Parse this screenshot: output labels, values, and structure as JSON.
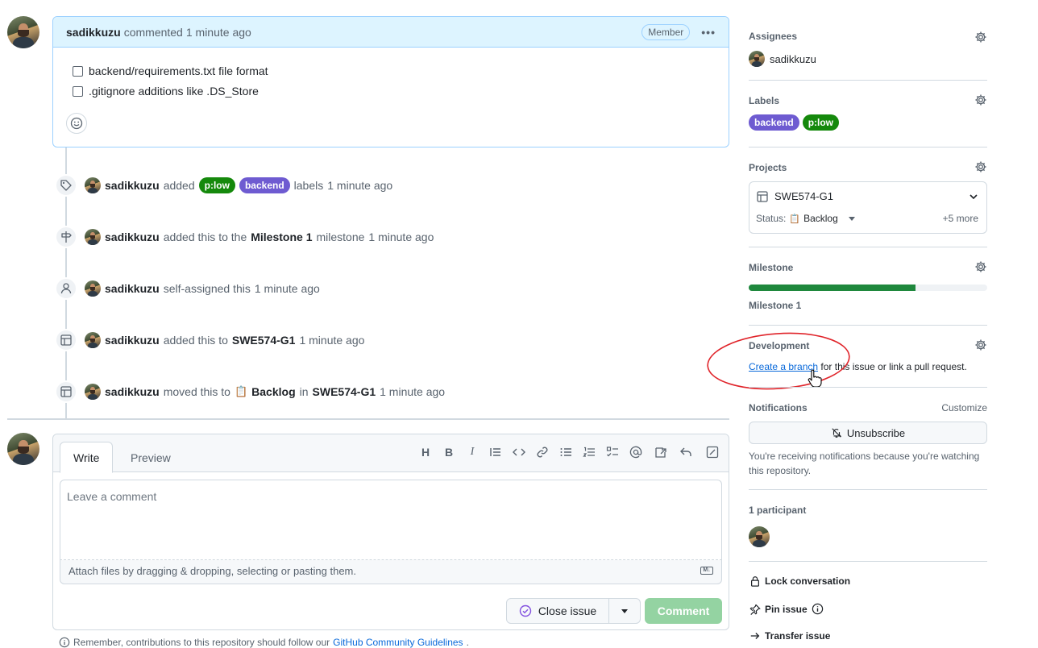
{
  "comment": {
    "author": "sadikkuzu",
    "action": "commented",
    "time": "1 minute ago",
    "role_badge": "Member",
    "tasks": [
      {
        "label": "backend/requirements.txt file format",
        "checked": false
      },
      {
        "label": ".gitignore additions like .DS_Store",
        "checked": false
      }
    ]
  },
  "timeline": {
    "labels_event": {
      "user": "sadikkuzu",
      "verb": "added",
      "label1": "p:low",
      "label2": "backend",
      "suffix": "labels",
      "time": "1 minute ago"
    },
    "milestone_event": {
      "user": "sadikkuzu",
      "verb": "added this to the",
      "target": "Milestone 1",
      "suffix": "milestone",
      "time": "1 minute ago"
    },
    "assign_event": {
      "user": "sadikkuzu",
      "verb": "self-assigned this",
      "time": "1 minute ago"
    },
    "project_event": {
      "user": "sadikkuzu",
      "verb": "added this to",
      "target": "SWE574-G1",
      "time": "1 minute ago"
    },
    "move_event": {
      "user": "sadikkuzu",
      "verb": "moved this to",
      "status": "Backlog",
      "in": "in",
      "target": "SWE574-G1",
      "time": "1 minute ago"
    }
  },
  "composer": {
    "tab_write": "Write",
    "tab_preview": "Preview",
    "placeholder": "Leave a comment",
    "attach_hint": "Attach files by dragging & dropping, selecting or pasting them.",
    "close_issue": "Close issue",
    "comment_button": "Comment",
    "guidelines_prefix": "Remember, contributions to this repository should follow our",
    "guidelines_link": "GitHub Community Guidelines",
    "guidelines_suffix": "."
  },
  "sidebar": {
    "assignees_title": "Assignees",
    "assignee": "sadikkuzu",
    "labels_title": "Labels",
    "labels": [
      {
        "name": "backend",
        "color": "#6e5bd1"
      },
      {
        "name": "p:low",
        "color": "#15890c"
      }
    ],
    "projects_title": "Projects",
    "project_name": "SWE574-G1",
    "status_label": "Status:",
    "status_value": "Backlog",
    "more": "+5 more",
    "milestone_title": "Milestone",
    "milestone_progress": 0.7,
    "milestone_name": "Milestone 1",
    "development_title": "Development",
    "dev_link": "Create a branch",
    "dev_text": "for this issue or link a pull request.",
    "notifications_title": "Notifications",
    "customize": "Customize",
    "unsubscribe": "Unsubscribe",
    "notif_reason": "You're receiving notifications because you're watching this repository.",
    "participants": "1 participant",
    "lock": "Lock conversation",
    "pin": "Pin issue",
    "transfer": "Transfer issue"
  },
  "colors": {
    "label_p_low": "#15890c",
    "label_backend": "#6e5bd1",
    "comment_header_bg": "#ddf4ff",
    "comment_button_bg": "#94d3a2",
    "milestone_bar": "#1f883d"
  }
}
